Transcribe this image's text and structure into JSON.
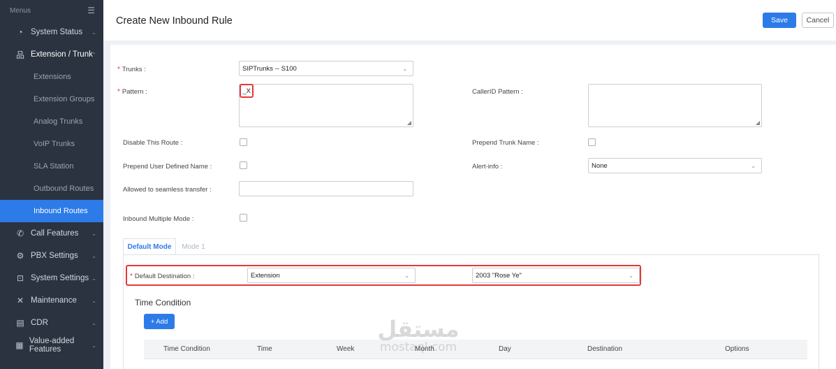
{
  "sidebar": {
    "menus_label": "Menus",
    "items": [
      {
        "label": "System Status",
        "icon": "gauge-icon",
        "glyph": "◔"
      },
      {
        "label": "Extension / Trunk",
        "icon": "network-icon",
        "glyph": "品"
      },
      {
        "label": "Call Features",
        "icon": "phone-icon",
        "glyph": "✆"
      },
      {
        "label": "PBX Settings",
        "icon": "gear-icon",
        "glyph": "⚙"
      },
      {
        "label": "System Settings",
        "icon": "settings-panel-icon",
        "glyph": "⊡"
      },
      {
        "label": "Maintenance",
        "icon": "tools-icon",
        "glyph": "✕"
      },
      {
        "label": "CDR",
        "icon": "document-icon",
        "glyph": "▤"
      },
      {
        "label": "Value-added Features",
        "icon": "apps-icon",
        "glyph": "▦"
      }
    ],
    "sub_items": [
      {
        "label": "Extensions"
      },
      {
        "label": "Extension Groups"
      },
      {
        "label": "Analog Trunks"
      },
      {
        "label": "VoIP Trunks"
      },
      {
        "label": "SLA Station"
      },
      {
        "label": "Outbound Routes"
      },
      {
        "label": "Inbound Routes"
      }
    ]
  },
  "header": {
    "title": "Create New Inbound Rule",
    "save_label": "Save",
    "cancel_label": "Cancel"
  },
  "form": {
    "trunks_label": "Trunks :",
    "trunks_value": "SIPTrunks -- S100",
    "pattern_label": "Pattern :",
    "pattern_value": "_X",
    "callerid_label": "CallerID Pattern :",
    "disable_route_label": "Disable This Route :",
    "prepend_trunk_label": "Prepend Trunk Name :",
    "prepend_user_label": "Prepend User Defined Name :",
    "alert_info_label": "Alert-info :",
    "alert_info_value": "None",
    "seamless_label": "Allowed to seamless transfer :",
    "multiple_mode_label": "Inbound Multiple Mode :"
  },
  "tabs": {
    "default_mode": "Default Mode",
    "mode1": "Mode 1"
  },
  "destination": {
    "label": "Default Destination :",
    "type_value": "Extension",
    "target_value": "2003 \"Rose Ye\""
  },
  "time_condition": {
    "title": "Time Condition",
    "add_label": "+ Add",
    "columns": [
      "Time Condition",
      "Time",
      "Week",
      "Month",
      "Day",
      "Destination",
      "Options"
    ]
  },
  "watermark": {
    "arabic": "مستقل",
    "latin": "mostaql.com"
  },
  "colors": {
    "accent": "#2d7be8",
    "sidebar_bg": "#2b3340",
    "highlight": "#e53935"
  }
}
